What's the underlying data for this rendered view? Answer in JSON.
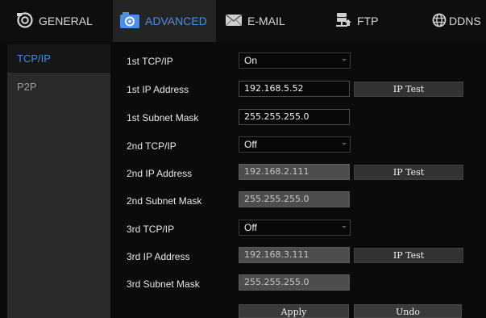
{
  "tabs": {
    "general": "GENERAL",
    "advanced": "ADVANCED",
    "email": "E-MAIL",
    "ftp": "FTP",
    "ddns": "DDNS"
  },
  "sidebar": {
    "items": [
      {
        "label": "TCP/IP",
        "active": true
      },
      {
        "label": "P2P",
        "active": false
      }
    ]
  },
  "settings": {
    "tcp1": {
      "label": "1st TCP/IP",
      "value": "On"
    },
    "ip1": {
      "label": "1st IP Address",
      "value": "192.168.5.52",
      "button": "IP Test"
    },
    "mask1": {
      "label": "1st Subnet Mask",
      "value": "255.255.255.0"
    },
    "tcp2": {
      "label": "2nd TCP/IP",
      "value": "Off"
    },
    "ip2": {
      "label": "2nd IP Address",
      "value": "192.168.2.111",
      "button": "IP Test"
    },
    "mask2": {
      "label": "2nd Subnet Mask",
      "value": "255.255.255.0"
    },
    "tcp3": {
      "label": "3rd TCP/IP",
      "value": "Off"
    },
    "ip3": {
      "label": "3rd IP Address",
      "value": "192.168.3.111",
      "button": "IP Test"
    },
    "mask3": {
      "label": "3rd Subnet Mask",
      "value": "255.255.255.0"
    }
  },
  "actions": {
    "apply": "Apply",
    "undo": "Undo"
  },
  "colors": {
    "accent": "#4a8ee8",
    "background": "#0b0b0b",
    "sidebar": "#2a2a2a",
    "disabled_field": "#4d4d4d",
    "button": "#333333"
  },
  "icons": {
    "general": "camera-lens-icon",
    "advanced": "advanced-camera-icon",
    "email": "envelope-icon",
    "ftp": "server-upload-icon",
    "ddns": "globe-icon"
  }
}
